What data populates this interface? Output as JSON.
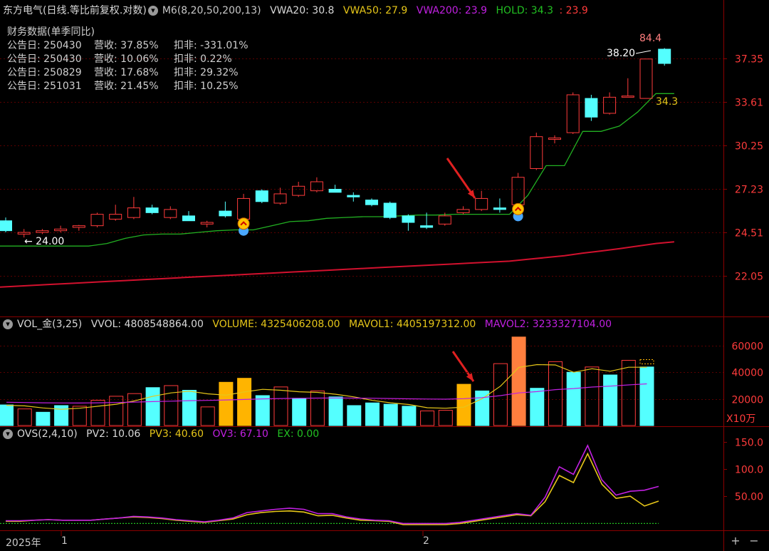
{
  "colors": {
    "bg": "#000000",
    "up": "#ff3b3b",
    "down": "#54ffff",
    "grid": "#5a0000",
    "hold": "#22b022",
    "vwa200": "#d2112e",
    "text": "#c8c8c8",
    "yellow": "#e6c619",
    "magenta": "#c020e0",
    "orange": "#ff7f3e",
    "gold": "#ffb400",
    "green": "#22c022"
  },
  "header": {
    "title": "东方电气(日线.等比前复权.对数)",
    "indicator": "M6(8,20,50,200,13)",
    "vwa20": "VWA20: 30.8",
    "vwa50": "VWA50: 27.9",
    "vwa200": "VWA200: 23.9",
    "hold": "HOLD: 34.3",
    "hold_extra": ": 23.9"
  },
  "finance": {
    "title": "财务数据(单季同比)",
    "rows": [
      {
        "date": "公告日: 250430",
        "rev": "营收: 37.85%",
        "nonrec": "扣非: -331.01%"
      },
      {
        "date": "公告日: 250430",
        "rev": "营收: 10.06%",
        "nonrec": "扣非: 0.22%"
      },
      {
        "date": "公告日: 250829",
        "rev": "营收: 17.68%",
        "nonrec": "扣非: 29.32%"
      },
      {
        "date": "公告日: 251031",
        "rev": "营收: 21.45%",
        "nonrec": "扣非: 10.25%"
      }
    ]
  },
  "vol_header": {
    "name": "VOL_金(3,25)",
    "vvol": "VVOL: 4808548864.00",
    "volume": "VOLUME: 4325406208.00",
    "mavol1": "MAVOL1: 4405197312.00",
    "mavol2": "MAVOL2: 3233327104.00"
  },
  "ovs_header": {
    "name": "OVS(2,4,10)",
    "pv2": "PV2: 10.06",
    "pv3": "PV3: 40.60",
    "ov3": "OV3: 67.10",
    "ex": "EX: 0.00"
  },
  "xaxis": {
    "year": "2025年",
    "month1": "1",
    "month2": "2"
  },
  "vol_unit": "X10万",
  "chart_data": [
    {
      "type": "candlestick",
      "title": "东方电气",
      "scale": "log",
      "yticks": [
        "37.35",
        "33.61",
        "30.25",
        "27.23",
        "24.51",
        "22.05"
      ],
      "ytick_values": [
        37.35,
        33.61,
        30.25,
        27.23,
        24.51,
        22.05
      ],
      "annotations": {
        "high_label": "84.4",
        "price_label": "38.20",
        "low_label": "24.00",
        "hold_label": "34.3"
      },
      "ohlc": [
        [
          25.2,
          25.4,
          24.5,
          24.6
        ],
        [
          24.4,
          24.7,
          24.2,
          24.5
        ],
        [
          24.5,
          24.7,
          24.4,
          24.6
        ],
        [
          24.6,
          24.9,
          24.5,
          24.7
        ],
        [
          24.8,
          24.95,
          24.6,
          24.9
        ],
        [
          24.9,
          25.7,
          24.8,
          25.6
        ],
        [
          25.3,
          26.2,
          25.2,
          25.6
        ],
        [
          25.4,
          26.7,
          25.3,
          26.0
        ],
        [
          26.0,
          26.2,
          25.6,
          25.7
        ],
        [
          25.4,
          26.1,
          25.3,
          25.9
        ],
        [
          25.5,
          25.8,
          25.2,
          25.2
        ],
        [
          25.0,
          25.2,
          24.8,
          25.1
        ],
        [
          25.8,
          26.4,
          25.4,
          25.5
        ],
        [
          25.3,
          26.9,
          25.2,
          26.6
        ],
        [
          27.1,
          27.2,
          26.3,
          26.4
        ],
        [
          26.3,
          27.3,
          26.2,
          26.9
        ],
        [
          26.8,
          27.7,
          26.7,
          27.4
        ],
        [
          27.1,
          28.0,
          27.0,
          27.7
        ],
        [
          27.2,
          27.5,
          27.0,
          27.0
        ],
        [
          26.8,
          27.0,
          26.4,
          26.7
        ],
        [
          26.5,
          26.6,
          26.1,
          26.2
        ],
        [
          26.3,
          26.4,
          25.3,
          25.4
        ],
        [
          25.5,
          25.6,
          24.6,
          25.1
        ],
        [
          24.9,
          25.7,
          24.7,
          24.8
        ],
        [
          25.0,
          25.7,
          24.9,
          25.5
        ],
        [
          25.7,
          26.1,
          25.6,
          25.9
        ],
        [
          25.9,
          27.1,
          25.8,
          26.6
        ],
        [
          26.0,
          26.6,
          25.7,
          25.9
        ],
        [
          26.2,
          28.3,
          26.1,
          28.0
        ],
        [
          28.6,
          31.2,
          28.5,
          30.9
        ],
        [
          30.7,
          31.0,
          30.4,
          30.8
        ],
        [
          31.2,
          34.4,
          31.1,
          34.2
        ],
        [
          33.9,
          34.2,
          32.1,
          32.4
        ],
        [
          32.7,
          34.4,
          32.6,
          34.0
        ],
        [
          34.0,
          35.6,
          34.0,
          34.1
        ],
        [
          33.9,
          37.3,
          33.9,
          37.3
        ],
        [
          38.2,
          38.3,
          36.7,
          36.9
        ]
      ],
      "vwa20": [
        23.7,
        23.7,
        23.7,
        23.7,
        23.7,
        23.7,
        23.85,
        24.15,
        24.35,
        24.4,
        24.4,
        24.5,
        24.6,
        24.65,
        24.65,
        24.9,
        25.15,
        25.2,
        25.35,
        25.4,
        25.45,
        25.45,
        25.5,
        25.55,
        25.55,
        25.6,
        25.6,
        25.6,
        25.6,
        26.8,
        28.8,
        28.8,
        31.3,
        31.3,
        31.7,
        32.8,
        34.3,
        34.3
      ],
      "vwa200": [
        21.45,
        21.5,
        21.55,
        21.6,
        21.65,
        21.7,
        21.75,
        21.8,
        21.85,
        21.9,
        21.95,
        22.0,
        22.05,
        22.1,
        22.15,
        22.2,
        22.25,
        22.3,
        22.35,
        22.4,
        22.45,
        22.5,
        22.55,
        22.6,
        22.65,
        22.7,
        22.75,
        22.8,
        22.85,
        22.95,
        23.05,
        23.15,
        23.3,
        23.42,
        23.55,
        23.7,
        23.85,
        23.95
      ]
    },
    {
      "type": "bar",
      "title": "VOL_金(3,25)",
      "unit": "X10万",
      "yticks": [
        "60000",
        "40000",
        "20000"
      ],
      "ytick_values": [
        60000,
        40000,
        20000
      ],
      "values": [
        15500,
        12500,
        10000,
        15000,
        14500,
        19000,
        22000,
        24000,
        28500,
        30000,
        26500,
        14000,
        32500,
        35500,
        22500,
        29000,
        20500,
        26000,
        21500,
        15000,
        17000,
        16000,
        14500,
        11000,
        11500,
        31000,
        26000,
        46500,
        66500,
        28000,
        48000,
        40000,
        44000,
        38000,
        49000,
        44000
      ],
      "bar_kinds": [
        "down",
        "up",
        "down",
        "down",
        "up",
        "up",
        "up",
        "up",
        "down",
        "up",
        "down",
        "up",
        "gold",
        "gold",
        "down",
        "up",
        "down",
        "up",
        "down",
        "down",
        "down",
        "down",
        "down",
        "up",
        "up",
        "gold",
        "down",
        "up",
        "orange",
        "down",
        "up",
        "down",
        "up",
        "down",
        "up",
        "down"
      ],
      "mavol1": [
        15200,
        14800,
        13200,
        12200,
        13000,
        14500,
        16000,
        18500,
        22000,
        24500,
        25800,
        23800,
        22800,
        25200,
        27200,
        26500,
        25400,
        24900,
        23500,
        21500,
        18900,
        17100,
        15800,
        13400,
        13000,
        13800,
        20200,
        29600,
        43700,
        45800,
        45500,
        40000,
        42700,
        40800,
        43800,
        43800
      ],
      "mavol2": [
        17500,
        17300,
        17100,
        17000,
        16900,
        17100,
        17300,
        17600,
        18000,
        18300,
        18700,
        18900,
        19200,
        19600,
        20000,
        20300,
        20500,
        20600,
        20700,
        20600,
        20500,
        20300,
        20100,
        19900,
        19800,
        20200,
        21000,
        22500,
        24500,
        25500,
        27000,
        27800,
        28900,
        29600,
        30500,
        31300
      ]
    },
    {
      "type": "line",
      "title": "OVS(2,4,10)",
      "yticks": [
        "150.0",
        "100.0",
        "50.00"
      ],
      "ytick_values": [
        150,
        100,
        50
      ],
      "series": [
        {
          "name": "PV3",
          "color": "#e6c619",
          "values": [
            4,
            4,
            6,
            7,
            6,
            6,
            6,
            8,
            10,
            12,
            11,
            9,
            6,
            4,
            2,
            5,
            8,
            16,
            20,
            22,
            23,
            21,
            14,
            15,
            10,
            6,
            5,
            4,
            -2,
            -2,
            -2,
            -2,
            0,
            4,
            8,
            12,
            16,
            14,
            40,
            88,
            75,
            128,
            72,
            46,
            50,
            32,
            41
          ]
        },
        {
          "name": "OV3",
          "color": "#c020e0",
          "values": [
            5,
            5,
            6,
            7,
            6,
            6,
            6,
            8,
            10,
            13,
            12,
            10,
            7,
            5,
            3,
            6,
            10,
            20,
            23,
            26,
            28,
            26,
            18,
            18,
            12,
            8,
            6,
            5,
            0,
            0,
            0,
            0,
            2,
            6,
            10,
            14,
            18,
            15,
            48,
            104,
            90,
            143,
            80,
            52,
            59,
            61,
            68
          ]
        }
      ]
    }
  ]
}
